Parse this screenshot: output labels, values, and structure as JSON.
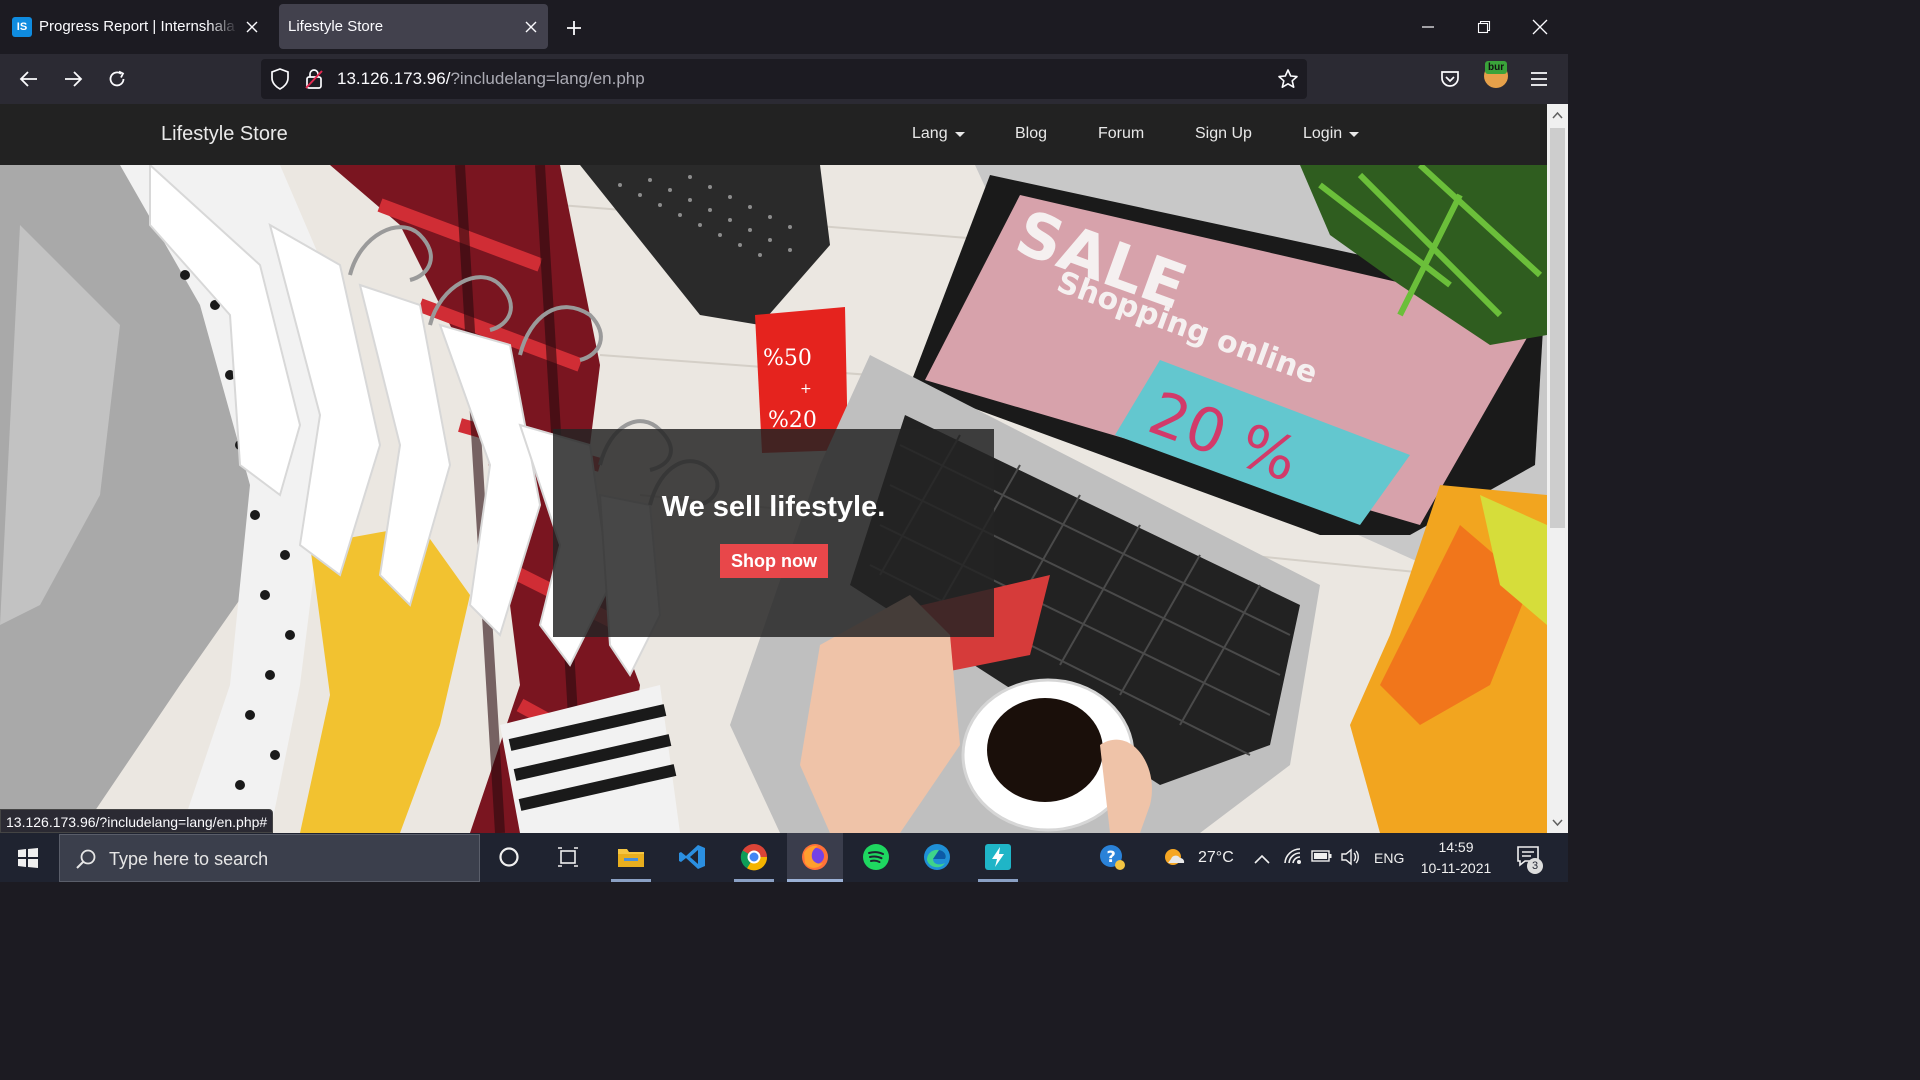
{
  "browser": {
    "tabs": [
      {
        "title": "Progress Report | Internshala Trainings",
        "favicon": "IS",
        "active": false
      },
      {
        "title": "Lifestyle Store",
        "active": true
      }
    ],
    "url_host": "13.126.173.96/",
    "url_path": "?includelang=lang/en.php",
    "extension_badge": "bur",
    "status_link": "13.126.173.96/?includelang=lang/en.php#"
  },
  "site": {
    "brand": "Lifestyle Store",
    "nav": [
      {
        "label": "Lang",
        "dropdown": true
      },
      {
        "label": "Blog",
        "dropdown": false
      },
      {
        "label": "Forum",
        "dropdown": false
      },
      {
        "label": "Sign Up",
        "dropdown": false
      },
      {
        "label": "Login",
        "dropdown": true
      }
    ],
    "hero": {
      "tagline": "We sell lifestyle.",
      "cta": "Shop now",
      "image_text": {
        "sale": "SALE",
        "shopping": "Shopping online",
        "discount": "20 %",
        "tag_top": "%50",
        "tag_plus": "+",
        "tag_bottom": "%20"
      }
    },
    "colors": {
      "navbar": "#222222",
      "cta": "#e8474a",
      "overlay": "#242424"
    }
  },
  "taskbar": {
    "search_placeholder": "Type here to search",
    "temperature": "27°C",
    "language": "ENG",
    "time": "14:59",
    "date": "10-11-2021",
    "notification_count": "3",
    "apps": [
      "cortana-icon",
      "task-view-icon",
      "file-explorer-icon",
      "vscode-icon",
      "chrome-icon",
      "firefox-icon",
      "spotify-icon",
      "edge-icon",
      "bolt-app-icon"
    ]
  }
}
